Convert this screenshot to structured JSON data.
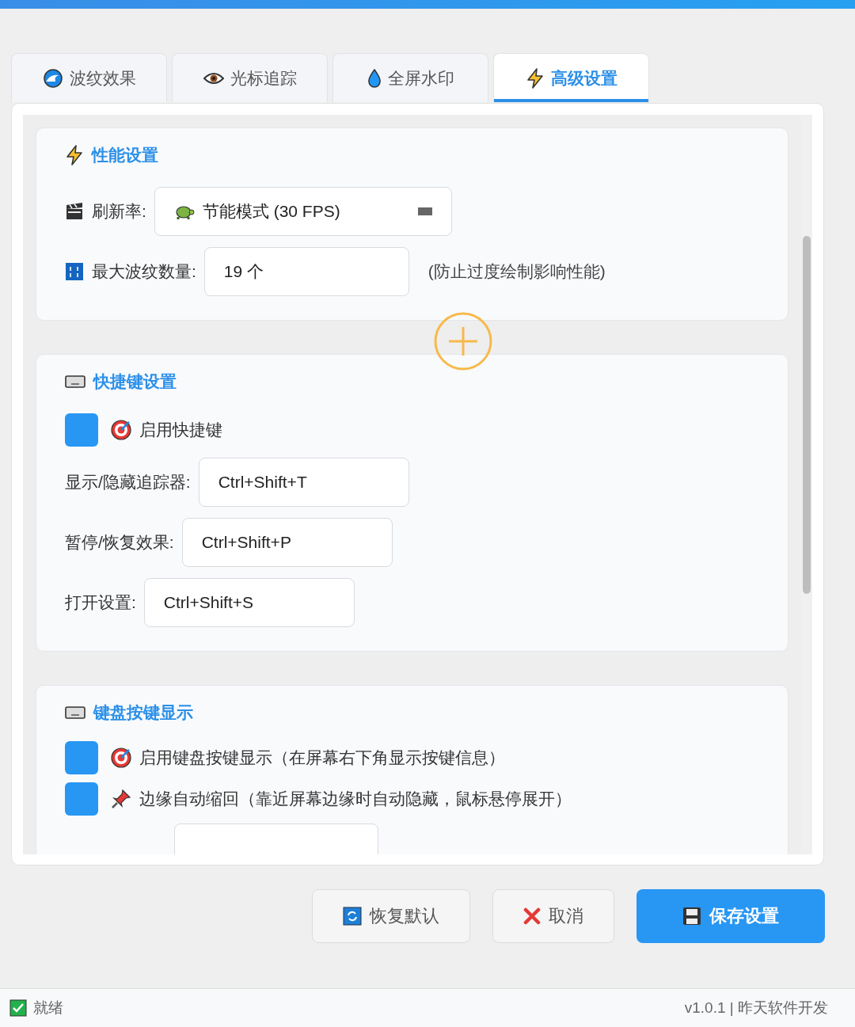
{
  "tabs": [
    {
      "label": "波纹效果",
      "selected": false
    },
    {
      "label": "光标追踪",
      "selected": false
    },
    {
      "label": "全屏水印",
      "selected": false
    },
    {
      "label": "高级设置",
      "selected": true
    }
  ],
  "performance": {
    "title": "性能设置",
    "refresh_rate": {
      "label": "刷新率:",
      "value": "节能模式 (30 FPS)"
    },
    "max_ripples": {
      "label": "最大波纹数量:",
      "value": "19 个",
      "note": "(防止过度绘制影响性能)"
    }
  },
  "hotkeys": {
    "title": "快捷键设置",
    "enable": {
      "label": "启用快捷键",
      "checked": true
    },
    "bindings": [
      {
        "label": "显示/隐藏追踪器:",
        "value": "Ctrl+Shift+T"
      },
      {
        "label": "暂停/恢复效果:",
        "value": "Ctrl+Shift+P"
      },
      {
        "label": "打开设置:",
        "value": "Ctrl+Shift+S"
      }
    ]
  },
  "key_display": {
    "title": "键盘按键显示",
    "options": [
      {
        "label": "启用键盘按键显示（在屏幕右下角显示按键信息）",
        "checked": true
      },
      {
        "label": "边缘自动缩回（靠近屏幕边缘时自动隐藏，鼠标悬停展开）",
        "checked": true
      }
    ]
  },
  "buttons": [
    {
      "label": "恢复默认",
      "kind": "reset"
    },
    {
      "label": "取消",
      "kind": "cancel"
    },
    {
      "label": "保存设置",
      "kind": "save"
    }
  ],
  "status_bar": {
    "status": "就绪",
    "version": "v1.0.1 | 昨天软件开发"
  }
}
